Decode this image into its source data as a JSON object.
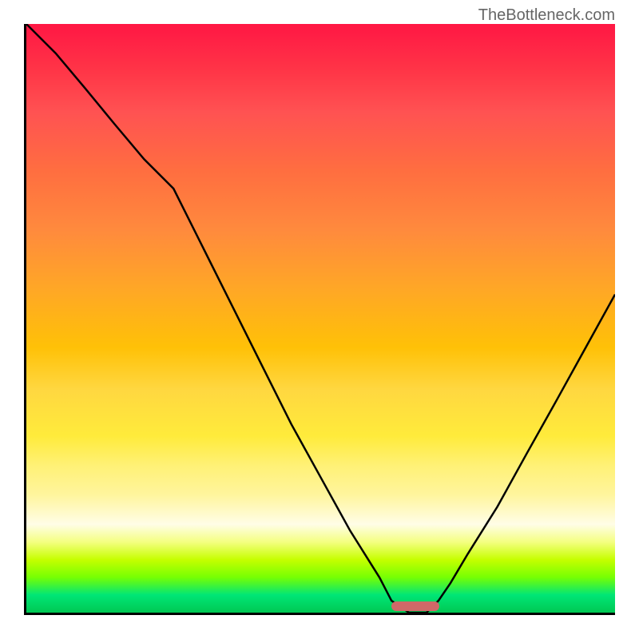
{
  "attribution": "TheBottleneck.com",
  "chart_data": {
    "type": "line",
    "title": "",
    "xlabel": "",
    "ylabel": "",
    "x": [
      0,
      5,
      10,
      15,
      20,
      25,
      30,
      35,
      40,
      45,
      50,
      55,
      60,
      62,
      65,
      68,
      70,
      72,
      75,
      80,
      85,
      90,
      95,
      100
    ],
    "values": [
      100,
      95,
      89,
      83,
      77,
      72,
      62,
      52,
      42,
      32,
      23,
      14,
      6,
      2,
      0,
      0,
      2,
      5,
      10,
      18,
      27,
      36,
      45,
      54
    ],
    "xlim": [
      0,
      100
    ],
    "ylim": [
      0,
      100
    ],
    "marker_position_x": 66,
    "background_gradient": [
      "#ff1744",
      "#ff5252",
      "#ff8a3d",
      "#ffc107",
      "#ffeb3b",
      "#fff59d",
      "#c6ff00",
      "#00e676",
      "#00c853"
    ]
  }
}
